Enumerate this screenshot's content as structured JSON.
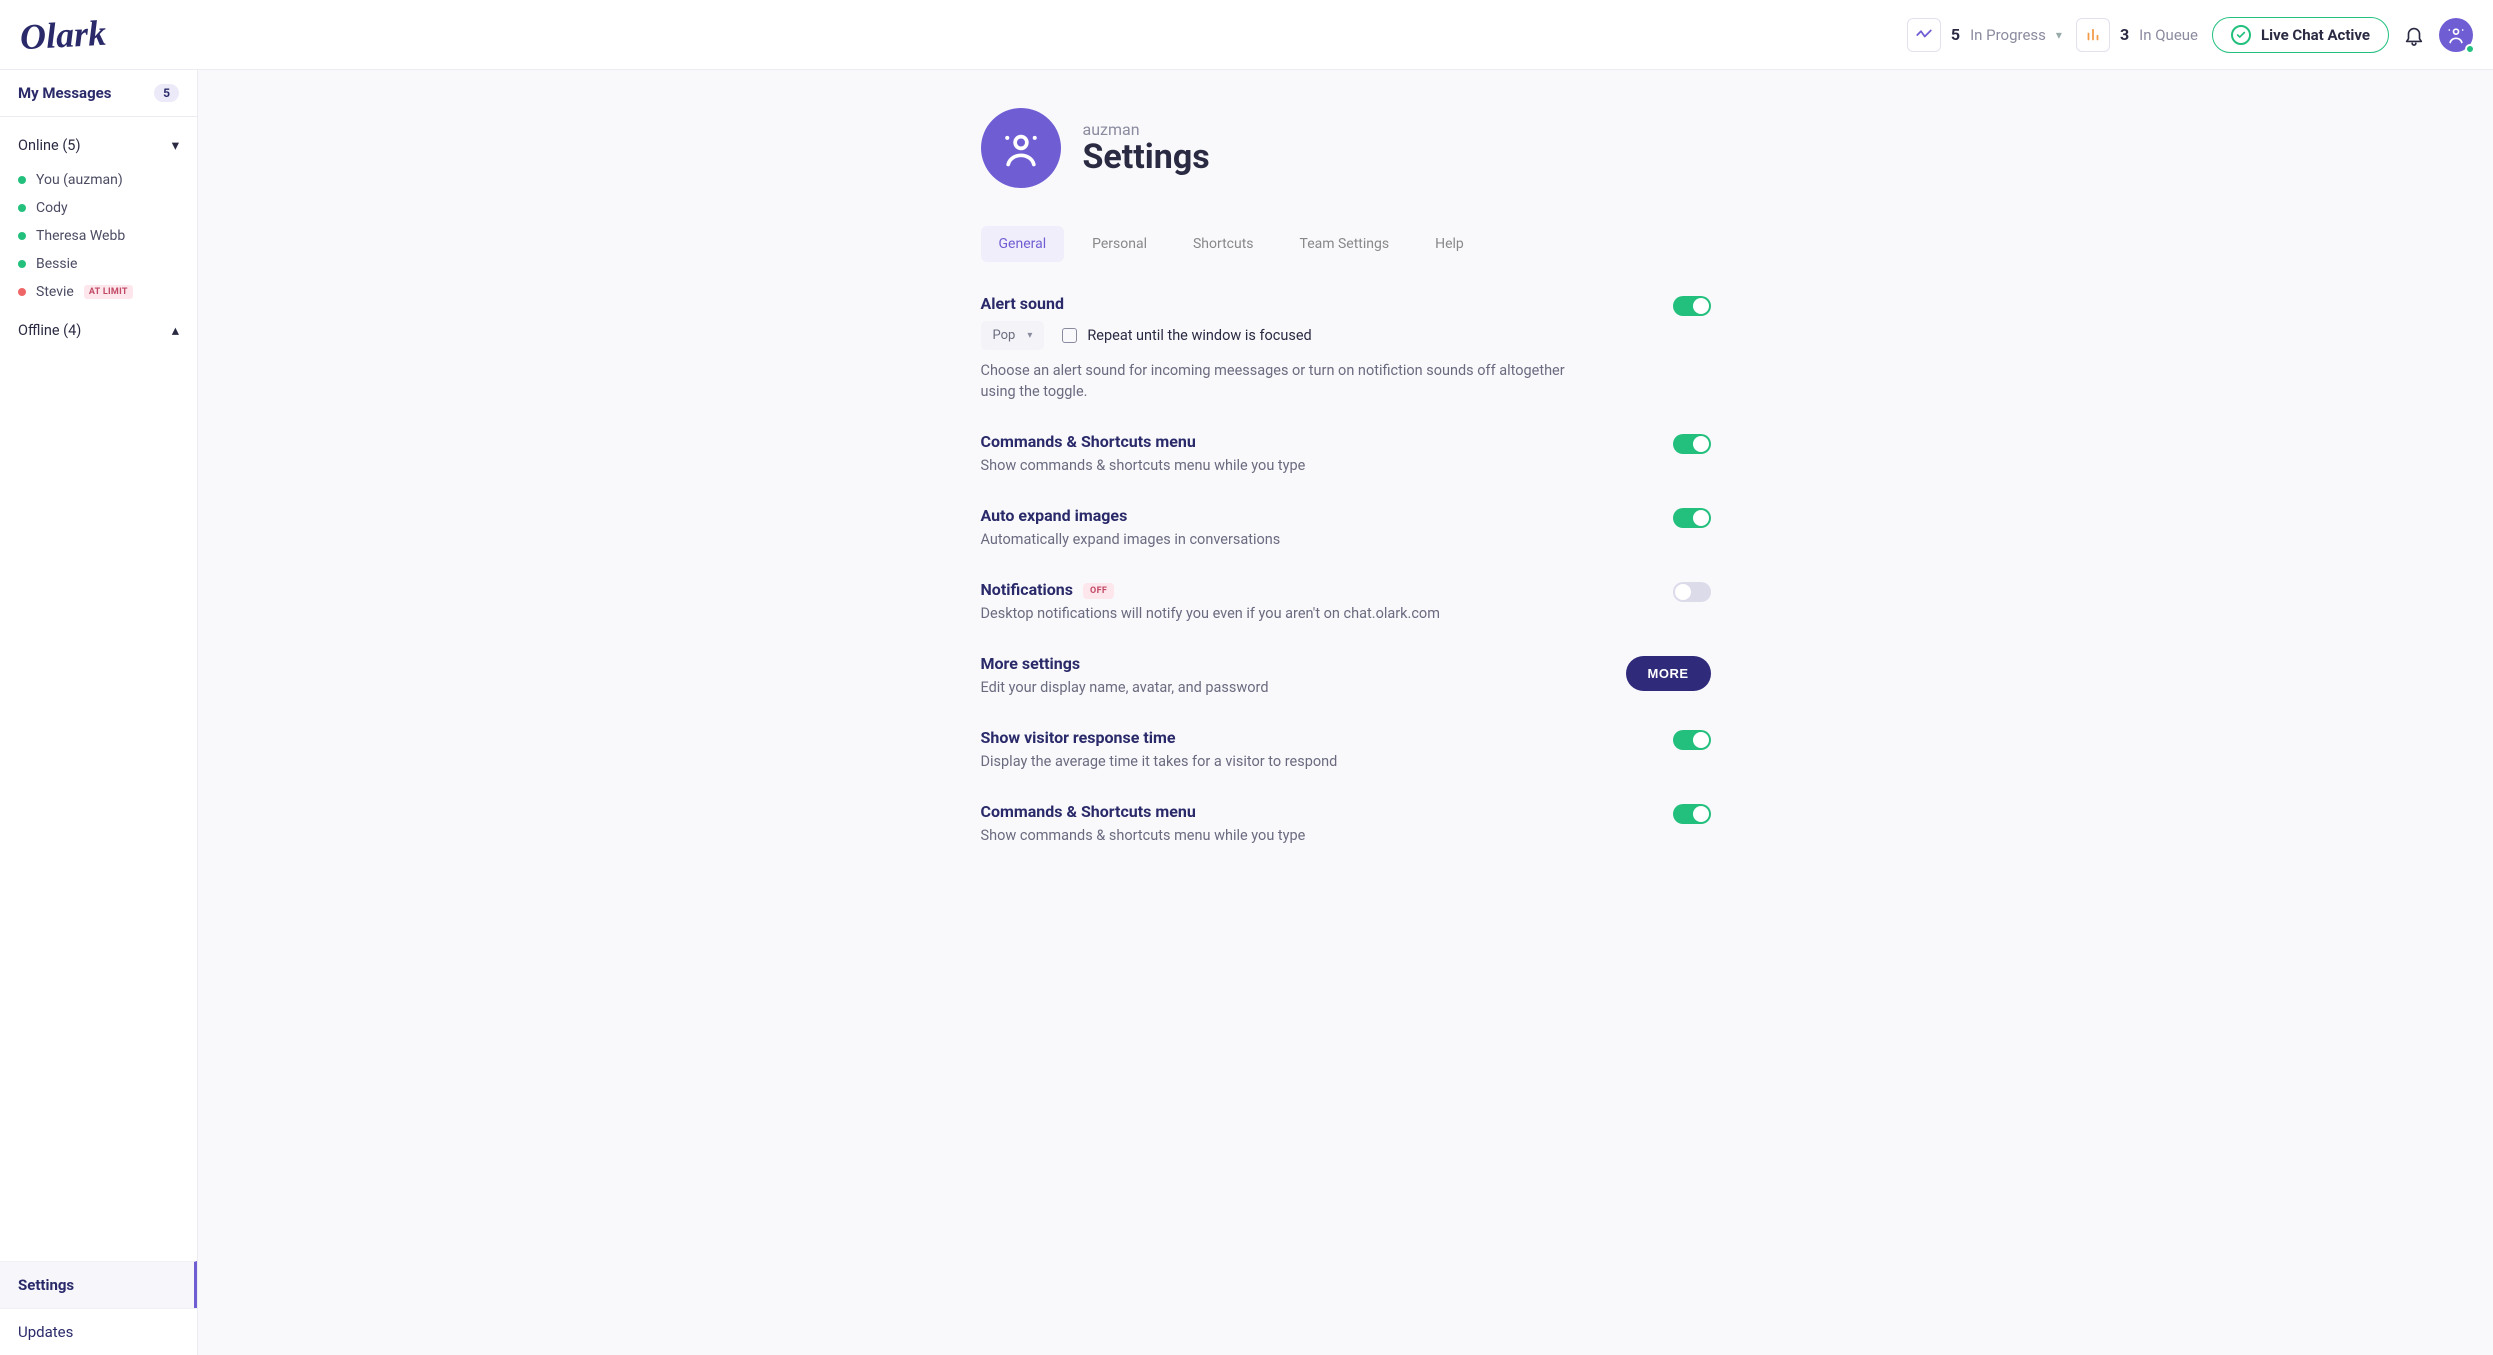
{
  "brand": "Olark",
  "topbar": {
    "progress": {
      "count": "5",
      "label": "In Progress"
    },
    "queue": {
      "count": "3",
      "label": "In Queue"
    },
    "live_chat_label": "Live Chat Active"
  },
  "sidebar": {
    "my_messages": {
      "label": "My Messages",
      "count": "5"
    },
    "online": {
      "label": "Online (5)",
      "items": [
        {
          "name": "You (auzman)",
          "status": "online"
        },
        {
          "name": "Cody",
          "status": "online"
        },
        {
          "name": "Theresa Webb",
          "status": "online"
        },
        {
          "name": "Bessie",
          "status": "online"
        },
        {
          "name": "Stevie",
          "status": "limit",
          "tag": "AT LIMIT"
        }
      ]
    },
    "offline": {
      "label": "Offline (4)"
    },
    "bottom": {
      "settings": "Settings",
      "updates": "Updates"
    }
  },
  "page": {
    "subtitle": "auzman",
    "title": "Settings",
    "tabs": [
      "General",
      "Personal",
      "Shortcuts",
      "Team Settings",
      "Help"
    ],
    "active_tab": 0
  },
  "settings": {
    "alert_sound": {
      "title": "Alert sound",
      "select_value": "Pop",
      "repeat_label": "Repeat until the window is focused",
      "desc": "Choose an alert sound for incoming meessages or turn on notifiction sounds off altogether using the toggle.",
      "on": true
    },
    "commands": {
      "title": "Commands & Shortcuts menu",
      "desc": "Show commands & shortcuts menu while you type",
      "on": true
    },
    "auto_expand": {
      "title": "Auto expand images",
      "desc": "Automatically expand images in conversations",
      "on": true
    },
    "notifications": {
      "title": "Notifications",
      "badge": "OFF",
      "desc": "Desktop notifications will notify you even if you aren't on chat.olark.com",
      "on": false
    },
    "more": {
      "title": "More settings",
      "desc": "Edit your display name, avatar, and password",
      "button": "MORE"
    },
    "visitor_response": {
      "title": "Show visitor response time",
      "desc": "Display the average time it takes for a visitor to respond",
      "on": true
    },
    "commands2": {
      "title": "Commands & Shortcuts menu",
      "desc": "Show commands & shortcuts menu while you type",
      "on": true
    }
  }
}
